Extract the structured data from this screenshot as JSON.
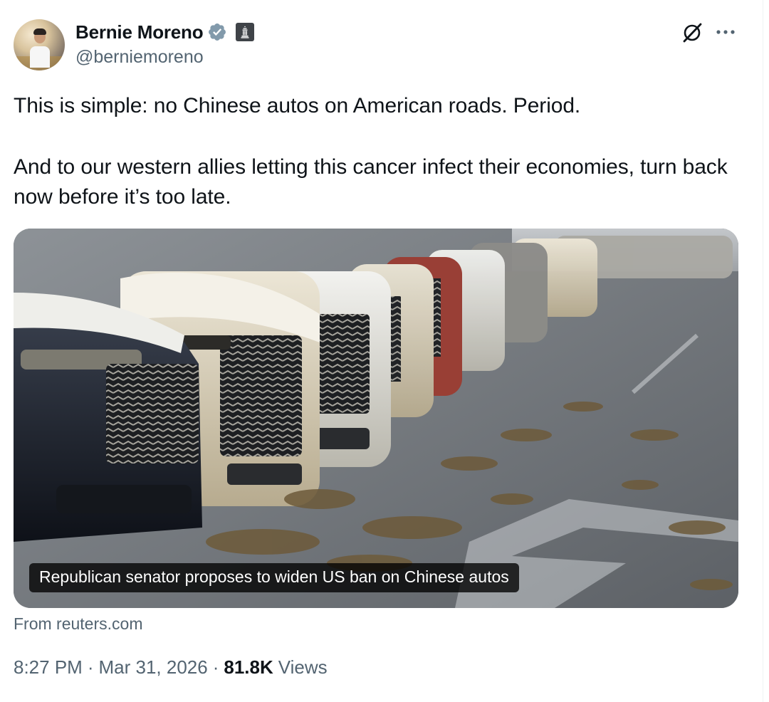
{
  "author": {
    "name": "Bernie Moreno",
    "handle": "@berniemoreno",
    "verified_color": "#829aab",
    "badge": "government-building-icon"
  },
  "actions": {
    "grok_icon": "grok-slash-icon",
    "more_icon": "ellipsis-icon"
  },
  "tweet": {
    "paragraph_1": "This is simple: no Chinese autos on American roads. Period.",
    "paragraph_2": "And to our western allies letting this cancer infect their economies, turn back now before it’s too late."
  },
  "card": {
    "caption": "Republican senator proposes to widen US ban on Chinese autos",
    "source": "From reuters.com",
    "image_description_icon": "car-lineup-photo"
  },
  "meta": {
    "time": "8:27 PM",
    "separator": "·",
    "date": "Mar 31, 2026",
    "views_count": "81.8K",
    "views_label": "Views"
  },
  "colors": {
    "text_primary": "#0f1419",
    "text_secondary": "#536471",
    "caption_bg": "#000000"
  }
}
